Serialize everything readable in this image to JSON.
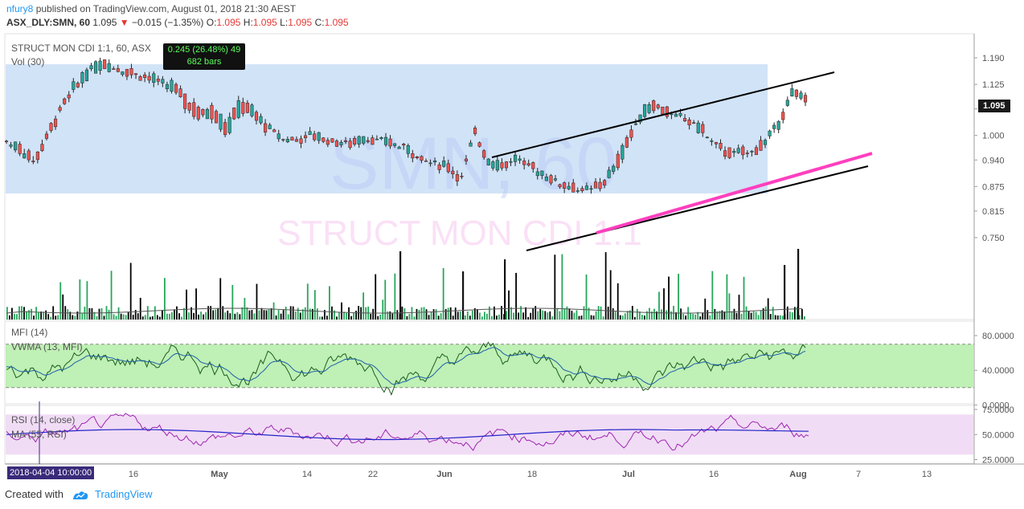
{
  "header": {
    "username": "nfury8",
    "published_text": "published on TradingView.com, August 01, 2018 21:30 AEST",
    "symbol": "ASX_DLY:SMN, 60",
    "last": "1.095",
    "change": "−0.015 (−1.35%)",
    "o_label": "O:",
    "o_value": "1.095",
    "h_label": "H:",
    "h_value": "1.095",
    "l_label": "L:",
    "l_value": "1.095",
    "c_label": "C:",
    "c_value": "1.095"
  },
  "colors": {
    "up": "#26a69a",
    "down": "#ef5350",
    "highlight_box": "#cfe2f7",
    "mfi_band": "#bff0b5",
    "rsi_band": "#f1dcf5",
    "mfi_line": "#1b5e20",
    "vwma_line": "#1e5fa8",
    "rsi_line": "#9c27b0",
    "rsi_ma_line": "#2525c9",
    "channel": "#000000",
    "support": "#ff3fbf",
    "volume_up": "#26a65b",
    "volume_down": "#000000"
  },
  "labels": {
    "main_title": "STRUCT MON CDI 1:1, 60, ASX",
    "volume": "Vol (30)",
    "mfi": "MFI (14)",
    "vwma": "VWMA (13, MFI)",
    "rsi": "RSI (14, close)",
    "rsi_ma": "MA (55, RSI)",
    "watermark_big": "SMN, 60",
    "watermark_small": "STRUCT MON CDI 1:1",
    "hover_line1": "0.245 (26.48%) 49",
    "hover_line2": "682 bars",
    "date_badge": "2018-04-04 10:00:00",
    "price_badge": "1.095"
  },
  "footer": {
    "created_with": "Created with",
    "brand": "TradingView"
  },
  "chart_data": {
    "type": "candlestick",
    "x_ticks": [
      "16",
      "May",
      "14",
      "22",
      "Jun",
      "18",
      "Jul",
      "16",
      "Aug",
      "7",
      "13"
    ],
    "price_axis": [
      "1.190",
      "1.125",
      "1.065",
      "1.000",
      "0.940",
      "0.875",
      "0.815",
      "0.750"
    ],
    "mfi_axis": [
      "80.0000",
      "40.0000",
      "0.0000"
    ],
    "rsi_axis": [
      "75.0000",
      "50.0000",
      "25.0000"
    ],
    "price_path": [
      [
        0.985,
        0.985
      ],
      [
        0.96,
        0.975
      ],
      [
        0.93,
        0.94
      ],
      [
        0.99,
        1.01
      ],
      [
        1.06,
        1.08
      ],
      [
        1.11,
        1.13
      ],
      [
        1.15,
        1.17
      ],
      [
        1.17,
        1.18
      ],
      [
        1.16,
        1.17
      ],
      [
        1.15,
        1.16
      ],
      [
        1.14,
        1.15
      ],
      [
        1.125,
        1.14
      ],
      [
        1.11,
        1.13
      ],
      [
        1.07,
        1.1
      ],
      [
        1.04,
        1.06
      ],
      [
        1.05,
        1.07
      ],
      [
        1.0,
        1.03
      ],
      [
        1.06,
        1.09
      ],
      [
        1.04,
        1.06
      ],
      [
        1.01,
        1.03
      ],
      [
        0.99,
        1.0
      ],
      [
        0.985,
        0.99
      ],
      [
        0.995,
        1.005
      ],
      [
        0.99,
        0.995
      ],
      [
        0.98,
        0.99
      ],
      [
        0.975,
        0.98
      ],
      [
        0.99,
        1.0
      ],
      [
        0.985,
        0.99
      ],
      [
        0.975,
        0.985
      ],
      [
        0.965,
        0.975
      ],
      [
        0.94,
        0.95
      ],
      [
        0.93,
        0.94
      ],
      [
        0.92,
        0.93
      ],
      [
        0.89,
        0.9
      ],
      [
        1.0,
        1.01
      ],
      [
        0.93,
        0.95
      ],
      [
        0.92,
        0.93
      ],
      [
        0.94,
        0.95
      ],
      [
        0.92,
        0.93
      ],
      [
        0.9,
        0.91
      ],
      [
        0.88,
        0.89
      ],
      [
        0.87,
        0.875
      ],
      [
        0.86,
        0.87
      ],
      [
        0.87,
        0.88
      ],
      [
        0.9,
        0.92
      ],
      [
        0.97,
        0.99
      ],
      [
        1.04,
        1.06
      ],
      [
        1.07,
        1.08
      ],
      [
        1.05,
        1.06
      ],
      [
        1.04,
        1.05
      ],
      [
        1.02,
        1.04
      ],
      [
        0.99,
        1.0
      ],
      [
        0.955,
        0.97
      ],
      [
        0.95,
        0.96
      ],
      [
        0.955,
        0.965
      ],
      [
        0.97,
        0.99
      ],
      [
        1.02,
        1.04
      ],
      [
        1.09,
        1.11
      ],
      [
        1.09,
        1.1
      ]
    ],
    "mfi_level_high": 70,
    "mfi_level_low": 20,
    "rsi_level_high": 70,
    "rsi_level_low": 30,
    "hover_stats": {
      "change": 0.245,
      "percent": 26.48,
      "bars": 682,
      "days": 49
    }
  }
}
